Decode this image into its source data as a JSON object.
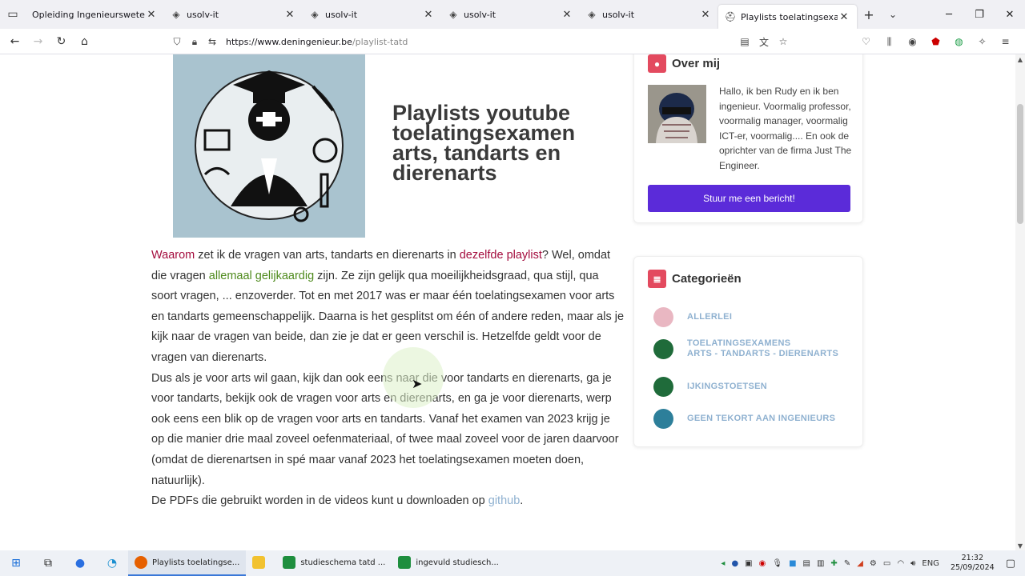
{
  "browser": {
    "tabs": [
      {
        "title": "Opleiding Ingenieurswetenschappen",
        "icon": "blank",
        "active": false
      },
      {
        "title": "usolv-it",
        "icon": "usolv-icon",
        "active": false
      },
      {
        "title": "usolv-it",
        "icon": "usolv-icon",
        "active": false
      },
      {
        "title": "usolv-it",
        "icon": "usolv-icon",
        "active": false
      },
      {
        "title": "usolv-it",
        "icon": "usolv-icon",
        "active": false
      },
      {
        "title": "Playlists toelatingsexamen arts",
        "icon": "site-icon",
        "active": true
      }
    ],
    "url_host": "https://www.deningenieur.be",
    "url_path": "/playlist-tatd"
  },
  "article": {
    "title": "Playlists youtube toelatingsexamen arts, tandarts en dierenarts",
    "p1": {
      "a": "Waarom",
      "b": " zet ik de vragen van arts, tandarts en dierenarts in ",
      "c": "dezelfde playlist",
      "d": "? Wel, omdat die vragen ",
      "e": "allemaal gelijkaardig",
      "f": " zijn. Ze zijn gelijk qua moeilijkheidsgraad, qua stijl, qua soort vragen, ... enzoverder. Tot en met 2017 was er maar één toelatingsexamen voor arts en tandarts gemeenschappelijk. Daarna is het gesplitst om één of andere reden, maar als je kijk naar de vragen van beide, dan zie je dat er geen verschil is. Hetzelfde geldt voor de vragen van dierenarts."
    },
    "p2": "Dus als je voor arts wil gaan, kijk dan ook eens naar die voor tandarts en dierenarts, ga je voor tandarts, bekijk ook de vragen voor arts en dierenarts, en ga je voor dierenarts, werp ook eens een blik op de vragen voor arts en tandarts. Vanaf het examen van 2023 krijg je op die manier drie maal zoveel oefenmateriaal, of twee maal zoveel voor de jaren daarvoor (omdat de dierenartsen in spé maar vanaf 2023 het toelatingsexamen moeten doen, natuurlijk).",
    "p3_text": "De PDFs die gebruikt worden in de videos kunt u downloaden op ",
    "p3_link": "github",
    "p3_end": "."
  },
  "sidebar": {
    "about": {
      "heading": "Over mij",
      "text": "Hallo, ik ben Rudy en ik ben ingenieur. Voormalig professor, voormalig manager, voormalig ICT-er, voormalig.... En ook de oprichter van de firma Just The Engineer.",
      "button": "Stuur me een bericht!"
    },
    "categories": {
      "heading": "Categorieën",
      "items": [
        {
          "line1": "ALLERLEI",
          "line2": "",
          "color": "#e9b7c2"
        },
        {
          "line1": "TOELATINGSEXAMENS",
          "line2": "ARTS - TANDARTS - DIERENARTS",
          "color": "#1f6b3a"
        },
        {
          "line1": "IJKINGSTOETSEN",
          "line2": "",
          "color": "#1f6b3a"
        },
        {
          "line1": "GEEN TEKORT AAN INGENIEURS",
          "line2": "",
          "color": "#2d7f9a"
        }
      ]
    }
  },
  "taskbar": {
    "apps": [
      {
        "label": "Playlists toelatingse...",
        "active": true,
        "color": "#e66000"
      },
      {
        "label": "",
        "active": false,
        "color": "#f2c230"
      },
      {
        "label": "studieschema tatd ...",
        "active": false,
        "color": "#1e8e3e"
      },
      {
        "label": "ingevuld studiesch...",
        "active": false,
        "color": "#1e8e3e"
      }
    ],
    "lang": "ENG",
    "time": "21:32",
    "date": "25/09/2024"
  }
}
